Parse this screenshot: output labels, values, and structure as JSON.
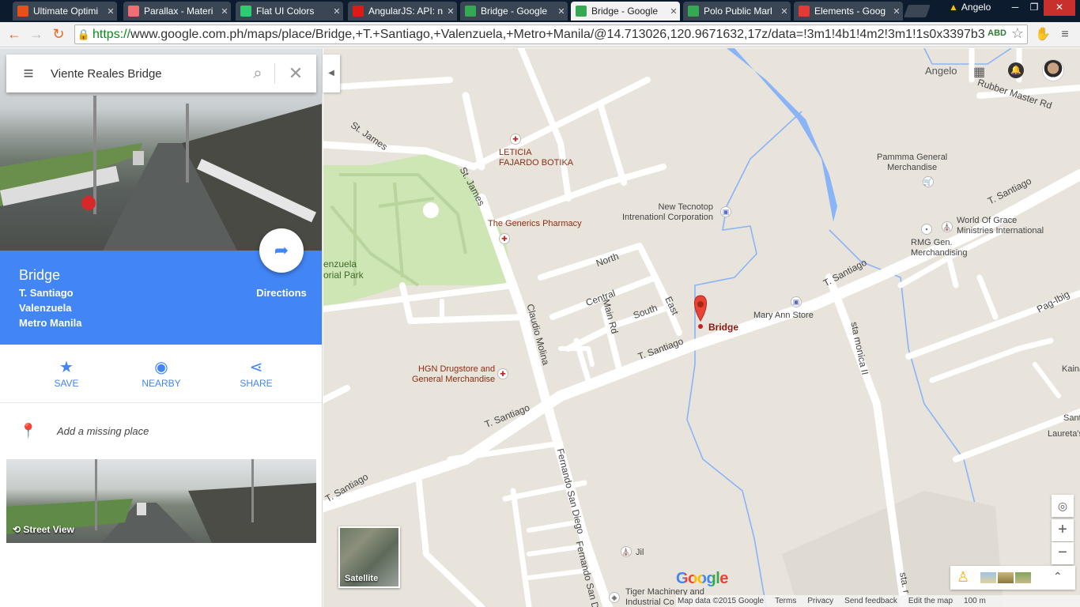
{
  "browser": {
    "tabs": [
      {
        "label": "Ultimate Optimi",
        "favicon_color": "#e8501a",
        "active": false
      },
      {
        "label": "Parallax - Materi",
        "favicon_color": "#ee6e73",
        "active": false
      },
      {
        "label": "Flat UI Colors",
        "favicon_color": "#2ecc71",
        "active": false
      },
      {
        "label": "AngularJS: API: n",
        "favicon_color": "#dd1b16",
        "active": false
      },
      {
        "label": "Bridge - Google",
        "favicon_color": "#34a853",
        "active": false
      },
      {
        "label": "Bridge - Google",
        "favicon_color": "#34a853",
        "active": true
      },
      {
        "label": "Polo Public Marl",
        "favicon_color": "#34a853",
        "active": false
      },
      {
        "label": "Elements - Goog",
        "favicon_color": "#e53935",
        "active": false
      }
    ],
    "profile_name": "Angelo",
    "url_scheme": "https://",
    "url_rest": "www.google.com.ph/maps/place/Bridge,+T.+Santiago,+Valenzuela,+Metro+Manila/@14.713026,120.9671632,17z/data=!3m1!4b1!4m2!3m1!1s0x3397b3",
    "extension_badge": "ABD"
  },
  "search": {
    "query": "Viente Reales Bridge"
  },
  "place": {
    "name": "Bridge",
    "address_lines": [
      "T. Santiago",
      "Valenzuela",
      "Metro Manila"
    ],
    "directions_label": "Directions"
  },
  "actions": {
    "save": "SAVE",
    "nearby": "NEARBY",
    "share": "SHARE"
  },
  "add_missing_place": "Add a missing place",
  "street_view_label": "Street View",
  "map": {
    "user_name": "Angelo",
    "pin_label": "Bridge",
    "satellite_label": "Satellite",
    "google_logo": "Google",
    "street_labels": {
      "st_james_1": "St. James",
      "st_james_2": "St. James",
      "north": "North",
      "central": "Central",
      "main_rd": "Main Rd",
      "south": "South",
      "east": "East",
      "claudio_molina": "Claudio Molina",
      "t_santiago_1": "T. Santiago",
      "t_santiago_2": "T. Santiago",
      "t_santiago_3": "T. Santiago",
      "t_santiago_4": "T. Santiago",
      "t_santiago_5": "T. Santiago",
      "fernando_san_diego": "Fernando San Diego",
      "fernando_san_d": "Fernando San D",
      "sta_monica": "sta monica II",
      "sta_r": "sta. r",
      "rubber_master": "Rubber Master Rd",
      "pag_ibig": "Pag-Ibig",
      "park_1": "enzuela",
      "park_2": "orial Park"
    },
    "pois": {
      "leticia_1": "LETICIA",
      "leticia_2": "FAJARDO BOTIKA",
      "generics": "The Generics Pharmacy",
      "tecnotop_1": "New Tecnotop",
      "tecnotop_2": "Intrenationl Corporation",
      "pammma_1": "Pammma General",
      "pammma_2": "Merchandise",
      "world_grace_1": "World Of Grace",
      "world_grace_2": "Ministries International",
      "rmg_1": "RMG Gen.",
      "rmg_2": "Merchandising",
      "mary_ann": "Mary Ann Store",
      "hgn_1": "HGN Drugstore and",
      "hgn_2": "General Merchandise",
      "jil": "Jil",
      "tiger_1": "Tiger Machinery and",
      "tiger_2": "Industrial Co",
      "kaina": "Kaina",
      "santi": "Santi",
      "laureta": "Laureta's"
    },
    "footer": {
      "map_data": "Map data ©2015 Google",
      "terms": "Terms",
      "privacy": "Privacy",
      "send_feedback": "Send feedback",
      "edit_map": "Edit the map",
      "scale": "100 m"
    },
    "colors": {
      "land": "#e8e4dc",
      "road": "#ffffff",
      "park": "#cde6b4",
      "water": "#8ab4f8",
      "pin": "#ea4335",
      "accent": "#4285f4"
    }
  }
}
